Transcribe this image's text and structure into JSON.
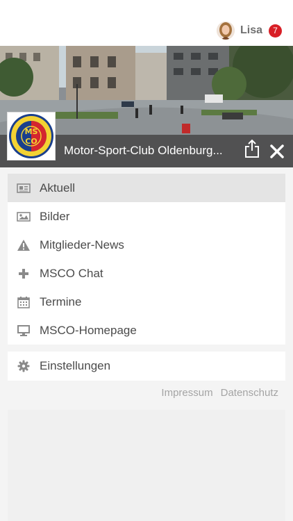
{
  "user": {
    "name": "Lisa",
    "notification_count": "7"
  },
  "club": {
    "title": "Motor-Sport-Club Oldenburg...",
    "logo_text": "MSCO",
    "logo_ring_text": "MOTOR-SPORT-CLUB OLDENBURG",
    "logo_bottom_text": "ADAC"
  },
  "menu": {
    "items": [
      {
        "label": "Aktuell",
        "icon": "newspaper-icon",
        "active": true
      },
      {
        "label": "Bilder",
        "icon": "image-icon",
        "active": false
      },
      {
        "label": "Mitglieder-News",
        "icon": "warning-icon",
        "active": false
      },
      {
        "label": "MSCO Chat",
        "icon": "plus-icon",
        "active": false
      },
      {
        "label": "Termine",
        "icon": "calendar-icon",
        "active": false
      },
      {
        "label": "MSCO-Homepage",
        "icon": "monitor-icon",
        "active": false
      }
    ]
  },
  "settings": {
    "label": "Einstellungen",
    "icon": "gear-icon"
  },
  "footer": {
    "impressum": "Impressum",
    "datenschutz": "Datenschutz"
  },
  "colors": {
    "badge": "#d81f26",
    "active_row": "#e4e4e4",
    "icon": "#8a8a8a"
  }
}
